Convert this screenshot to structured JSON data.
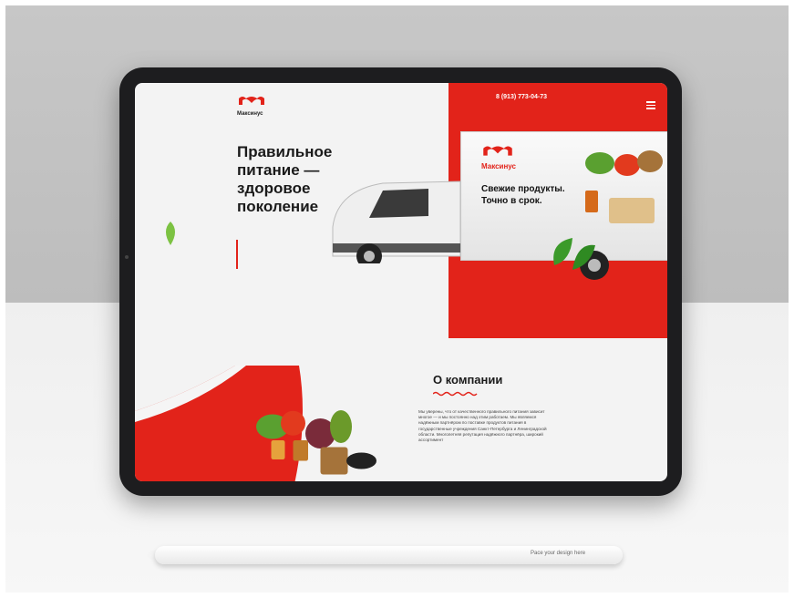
{
  "colors": {
    "brand_red": "#e2231a",
    "dark_text": "#1a1a1a"
  },
  "header": {
    "logo_text": "Максинус",
    "phone": "8 (913) 773-04-73",
    "menu_icon": "hamburger-icon"
  },
  "hero": {
    "title": "Правильное питание — здоровое поколение"
  },
  "truck": {
    "logo_text": "Максинус",
    "slogan_line1": "Свежие продукты.",
    "slogan_line2": "Точно в срок."
  },
  "about": {
    "title": "О компании",
    "text": "Мы уверены, что от качественного правильного питания зависит многое — и мы постоянно над этим работаем. Мы являемся надёжным партнёром по поставке продуктов питания в государственные учреждения Санкт-Петербурга и Ленинградской области. Многолетняя репутация надёжного партнёра, широкий ассортимент"
  },
  "pencil": {
    "label": "Pace your design here"
  }
}
